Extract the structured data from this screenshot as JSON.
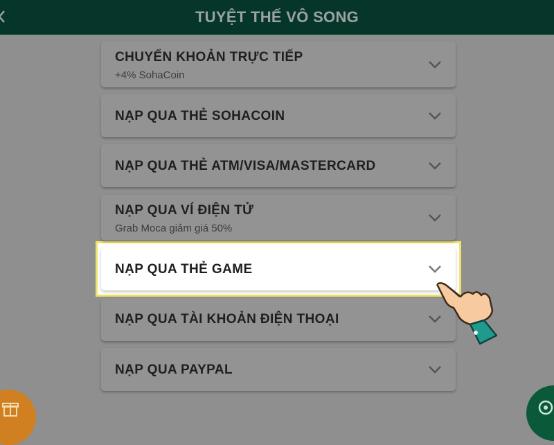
{
  "header": {
    "title": "TUYỆT THẾ VÔ SONG"
  },
  "payment_methods": [
    {
      "label": "CHUYỂN KHOẢN TRỰC TIẾP",
      "sub": "+4% SohaCoin"
    },
    {
      "label": "NẠP QUA THẺ SOHACOIN",
      "sub": ""
    },
    {
      "label": "NẠP QUA THẺ ATM/VISA/MASTERCARD",
      "sub": ""
    },
    {
      "label": "NẠP QUA VÍ ĐIỆN TỬ",
      "sub": "Grab Moca giảm giá 50%"
    },
    {
      "label": "NẠP QUA THẺ GAME",
      "sub": ""
    },
    {
      "label": "NẠP QUA TÀI KHOẢN ĐIỆN THOẠI",
      "sub": ""
    },
    {
      "label": "NẠP QUA PAYPAL",
      "sub": ""
    }
  ],
  "highlighted_item": "NẠP QUA THẺ GAME",
  "icons": {
    "back": "chevron-left-icon",
    "expand": "chevron-down-icon",
    "gift": "gift-icon",
    "support": "support-icon",
    "pointer": "hand-pointer-icon"
  },
  "colors": {
    "header_bg": "#06352a",
    "highlight_border": "#efe36a",
    "gift_button": "#d08020",
    "support_button": "#0a5a3a"
  }
}
